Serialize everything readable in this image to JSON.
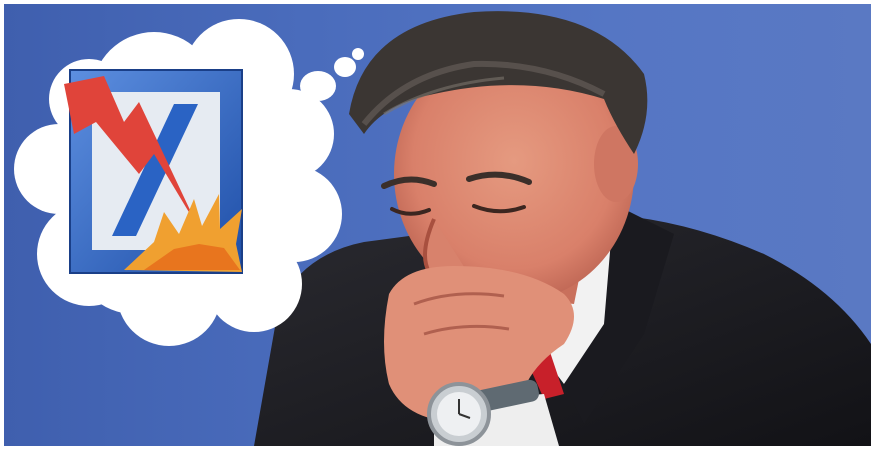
{
  "image": {
    "subject": "man-laughing-with-hand-on-chin",
    "background_color": "#4a6cbc",
    "suit_color": "#1d1d22",
    "shirt_color": "#f2f2f2",
    "tie_color": "#c8202a",
    "skin_color": "#d9806a",
    "hair_color": "#3b3633"
  },
  "thought_bubble": {
    "cloud_color": "#ffffff",
    "logo": {
      "name": "bank-logo-slash-icon",
      "frame_color": "#2f5fb0",
      "slash_color": "#1f4fa8",
      "lightning_color": "#e0443a",
      "burst_color": "#f0a030"
    }
  }
}
